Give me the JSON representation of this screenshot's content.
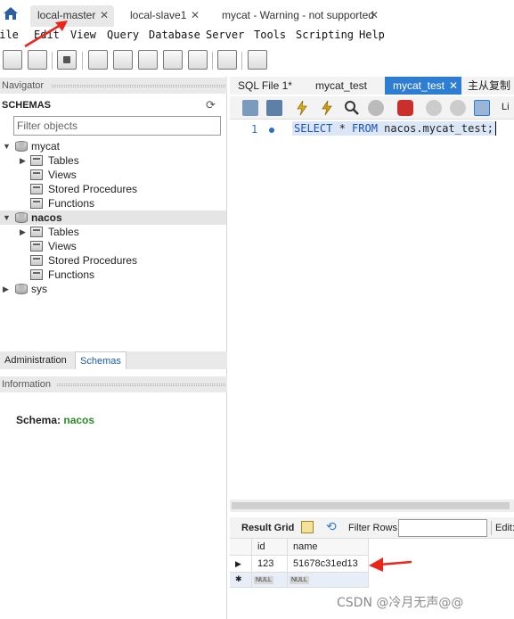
{
  "connection_tabs": [
    {
      "label": "local-master"
    },
    {
      "label": "local-slave1"
    },
    {
      "label": "mycat - Warning - not supported"
    }
  ],
  "menu": [
    "File",
    "Edit",
    "View",
    "Query",
    "Database",
    "Server",
    "Tools",
    "Scripting",
    "Help"
  ],
  "navigator": {
    "header": "Navigator",
    "schemas_label": "SCHEMAS",
    "filter_placeholder": "Filter objects",
    "schemas": [
      {
        "name": "mycat",
        "children": [
          "Tables",
          "Views",
          "Stored Procedures",
          "Functions"
        ]
      },
      {
        "name": "nacos",
        "children": [
          "Tables",
          "Views",
          "Stored Procedures",
          "Functions"
        ]
      },
      {
        "name": "sys"
      }
    ]
  },
  "bottom_tabs": [
    "Administration",
    "Schemas"
  ],
  "information": {
    "header": "Information",
    "schema_label": "Schema:",
    "schema_value": "nacos"
  },
  "query_tabs": [
    "SQL File 1*",
    "mycat_test",
    "mycat_test",
    "主从复制"
  ],
  "editor": {
    "line_number": "1",
    "sql": {
      "kw1": "SELECT",
      "star": " * ",
      "kw2": "FROM",
      "rest": " nacos.mycat_test;"
    }
  },
  "toolbar_cut_label": "Li",
  "result_toolbar": {
    "result_grid": "Result Grid",
    "filter_rows": "Filter Rows:",
    "edit": "Edit:"
  },
  "result_grid": {
    "columns": [
      "id",
      "name"
    ],
    "rows": [
      {
        "id": "123",
        "name": "51678c31ed13"
      }
    ],
    "null_label": "NULL"
  },
  "watermark": "CSDN @冷月无声@@",
  "colors": {
    "accent": "#2d7dd2",
    "schema_value": "#2a8a2a",
    "annotation_arrow": "#e8261c"
  }
}
